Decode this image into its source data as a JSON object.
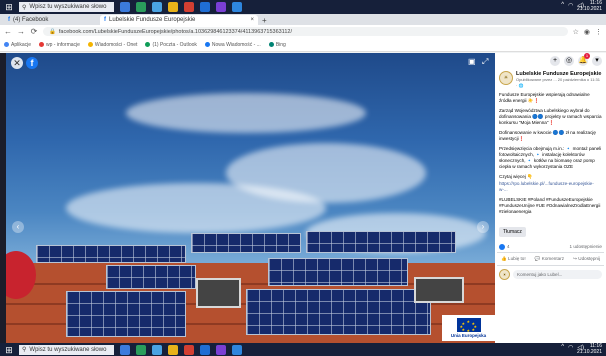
{
  "taskbar": {
    "search_placeholder": "Wpisz tu wyszukiwane słowo",
    "time": "11:16",
    "date": "21.10.2021",
    "apps": [
      {
        "color": "#3b7bdc"
      },
      {
        "color": "#2a9d5c"
      },
      {
        "color": "#4aa3e3"
      },
      {
        "color": "#e8b21a"
      },
      {
        "color": "#d33f32"
      },
      {
        "color": "#1f6ed4"
      },
      {
        "color": "#7a3fd4"
      },
      {
        "color": "#2e86de"
      }
    ]
  },
  "browser": {
    "tabs": [
      {
        "title": "(4) Facebook"
      },
      {
        "title": "Lubelskie Fundusze Europejskie"
      }
    ],
    "url": "facebook.com/LubelskieFunduszeEuropejskie/photos/a.103629846123374/4113963715363112/",
    "bookmarks": [
      "Aplikacje",
      "wp - informacje",
      "Wiadomości - Onet",
      "(1) Poczta - Outlook",
      "Nowa Wiadomość - ...",
      "Bing"
    ]
  },
  "viewer": {
    "eu_label": "Unia Europejska"
  },
  "post": {
    "page_name": "Lubelskie Fundusze Europejskie",
    "meta": "Opublikowane przez ... 20 października o 11:31 · 🌐",
    "paragraphs": [
      "Fundusze Europejskie wspierają odnawialne źródła energii ☀️❗",
      "Zarząd Województwa Lubelskiego wybrał do dofinansowania 🔵🔵 projekty w ramach wsparcia konkursu \"Moja Mienna\"❗",
      "Dofinansowanie w kwocie 🔵🔵 zł na realizację inwestycji❗",
      "Przedsięwzięcia obejmują m.in.: 🔹 montaż paneli fotowoltaicznych, 🔹 instalację kolektorów słonecznych, 🔹 kotłów na biomasę oraz pomp ciepła w ramach wykorzystania OZE",
      "Czytaj więcej 👇"
    ],
    "link": "https://rpo.lubelskie.pl/...fundusze-europejskie-w-...",
    "hashtags": "#LUBELSKIE #Poland #FunduszeEuropejskie #FunduszeUnijne #UE #OdnawialneZrodlaEnergii #zielonaenergia",
    "translate_button": "Tłumacz",
    "reaction_count": "4",
    "share_count": "1 udostępnienie",
    "actions": [
      "Lubię to!",
      "Komentarz",
      "Udostępnij"
    ],
    "comment_placeholder": "Komentuj jako Lubel..."
  }
}
